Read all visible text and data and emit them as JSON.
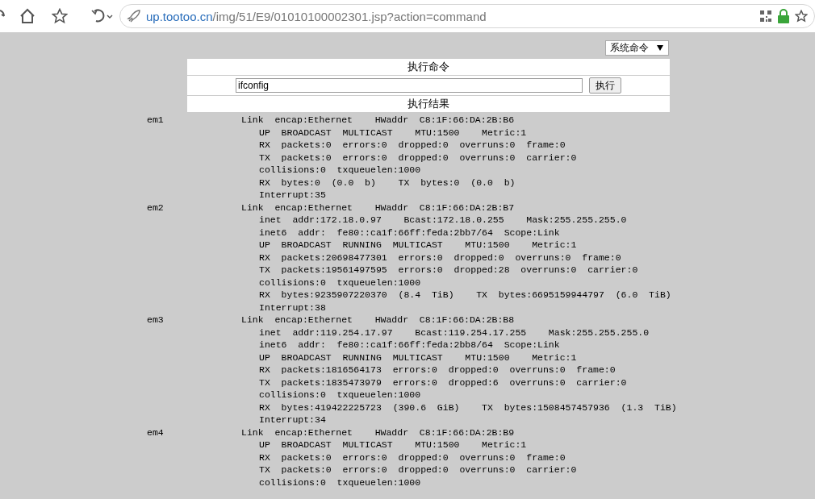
{
  "toolbar": {
    "url_host": "up.tootoo.cn",
    "url_path": "/img/51/E9/01010100002301.jsp?action=command"
  },
  "mode_select": {
    "value": "系统命令"
  },
  "command_panel": {
    "heading": "执行命令",
    "command_input": {
      "value": "ifconfig"
    },
    "run_button": "执行",
    "result_heading": "执行结果"
  },
  "output": [
    {
      "interface": "em1",
      "lines": [
        "Link  encap:Ethernet    HWaddr  C8:1F:66:DA:2B:B6",
        "UP  BROADCAST  MULTICAST    MTU:1500    Metric:1",
        "RX  packets:0  errors:0  dropped:0  overruns:0  frame:0",
        "TX  packets:0  errors:0  dropped:0  overruns:0  carrier:0",
        "collisions:0  txqueuelen:1000",
        "RX  bytes:0  (0.0  b)    TX  bytes:0  (0.0  b)",
        "Interrupt:35"
      ]
    },
    {
      "interface": "em2",
      "lines": [
        "Link  encap:Ethernet    HWaddr  C8:1F:66:DA:2B:B7",
        "inet  addr:172.18.0.97    Bcast:172.18.0.255    Mask:255.255.255.0",
        "inet6  addr:  fe80::ca1f:66ff:feda:2bb7/64  Scope:Link",
        "UP  BROADCAST  RUNNING  MULTICAST    MTU:1500    Metric:1",
        "RX  packets:20698477301  errors:0  dropped:0  overruns:0  frame:0",
        "TX  packets:19561497595  errors:0  dropped:28  overruns:0  carrier:0",
        "collisions:0  txqueuelen:1000",
        "RX  bytes:9235907220370  (8.4  TiB)    TX  bytes:6695159944797  (6.0  TiB)",
        "Interrupt:38"
      ]
    },
    {
      "interface": "em3",
      "lines": [
        "Link  encap:Ethernet    HWaddr  C8:1F:66:DA:2B:B8",
        "inet  addr:119.254.17.97    Bcast:119.254.17.255    Mask:255.255.255.0",
        "inet6  addr:  fe80::ca1f:66ff:feda:2bb8/64  Scope:Link",
        "UP  BROADCAST  RUNNING  MULTICAST    MTU:1500    Metric:1",
        "RX  packets:1816564173  errors:0  dropped:0  overruns:0  frame:0",
        "TX  packets:1835473979  errors:0  dropped:6  overruns:0  carrier:0",
        "collisions:0  txqueuelen:1000",
        "RX  bytes:419422225723  (390.6  GiB)    TX  bytes:1508457457936  (1.3  TiB)",
        "Interrupt:34"
      ]
    },
    {
      "interface": "em4",
      "lines": [
        "Link  encap:Ethernet    HWaddr  C8:1F:66:DA:2B:B9",
        "UP  BROADCAST  MULTICAST    MTU:1500    Metric:1",
        "RX  packets:0  errors:0  dropped:0  overruns:0  frame:0",
        "TX  packets:0  errors:0  dropped:0  overruns:0  carrier:0",
        "collisions:0  txqueuelen:1000"
      ]
    }
  ]
}
